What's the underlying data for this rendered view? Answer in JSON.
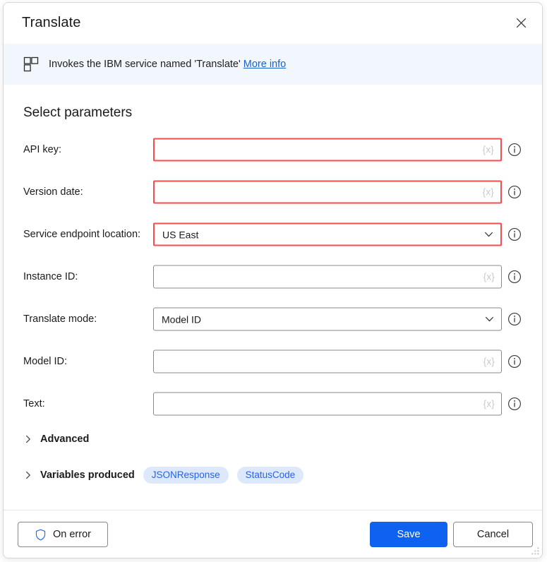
{
  "window": {
    "title": "Translate",
    "close_icon": "close-icon",
    "resize_grip": "resize-grip"
  },
  "banner": {
    "icon": "module-grid-icon",
    "text": "Invokes the IBM service named 'Translate'",
    "link_label": "More info"
  },
  "main": {
    "section_title": "Select parameters",
    "fields": [
      {
        "label": "API key:",
        "type": "text",
        "value": "",
        "token": "{x}",
        "invalid": true,
        "info_icon": "info-icon"
      },
      {
        "label": "Version date:",
        "type": "text",
        "value": "",
        "token": "{x}",
        "invalid": true,
        "info_icon": "info-icon"
      },
      {
        "label": "Service endpoint location:",
        "type": "select",
        "value": "US East",
        "token": "",
        "invalid": true,
        "info_icon": "info-icon",
        "chevron_icon": "chevron-down-icon"
      },
      {
        "label": "Instance ID:",
        "type": "text",
        "value": "",
        "token": "{x}",
        "invalid": false,
        "info_icon": "info-icon"
      },
      {
        "label": "Translate mode:",
        "type": "select",
        "value": "Model ID",
        "token": "",
        "invalid": false,
        "info_icon": "info-icon",
        "chevron_icon": "chevron-down-icon"
      },
      {
        "label": "Model ID:",
        "type": "text",
        "value": "",
        "token": "{x}",
        "invalid": false,
        "info_icon": "info-icon"
      },
      {
        "label": "Text:",
        "type": "text",
        "value": "",
        "token": "{x}",
        "invalid": false,
        "info_icon": "info-icon"
      }
    ],
    "advanced": {
      "label": "Advanced",
      "caret_icon": "chevron-right-icon",
      "expanded": false
    },
    "variables_produced": {
      "label": "Variables produced",
      "caret_icon": "chevron-right-icon",
      "expanded": false,
      "pills": [
        "JSONResponse",
        "StatusCode"
      ]
    }
  },
  "footer": {
    "on_error_label": "On error",
    "on_error_icon": "shield-icon",
    "save_label": "Save",
    "cancel_label": "Cancel"
  },
  "colors": {
    "accent": "#0f62ef",
    "link": "#1b5fd0",
    "error_border": "#f54d4d",
    "banner_bg": "#f2f6fd",
    "pill_bg": "#dde9fb",
    "pill_text": "#2563eb",
    "field_border": "#8a8886",
    "token_text": "#c9c9c9"
  }
}
